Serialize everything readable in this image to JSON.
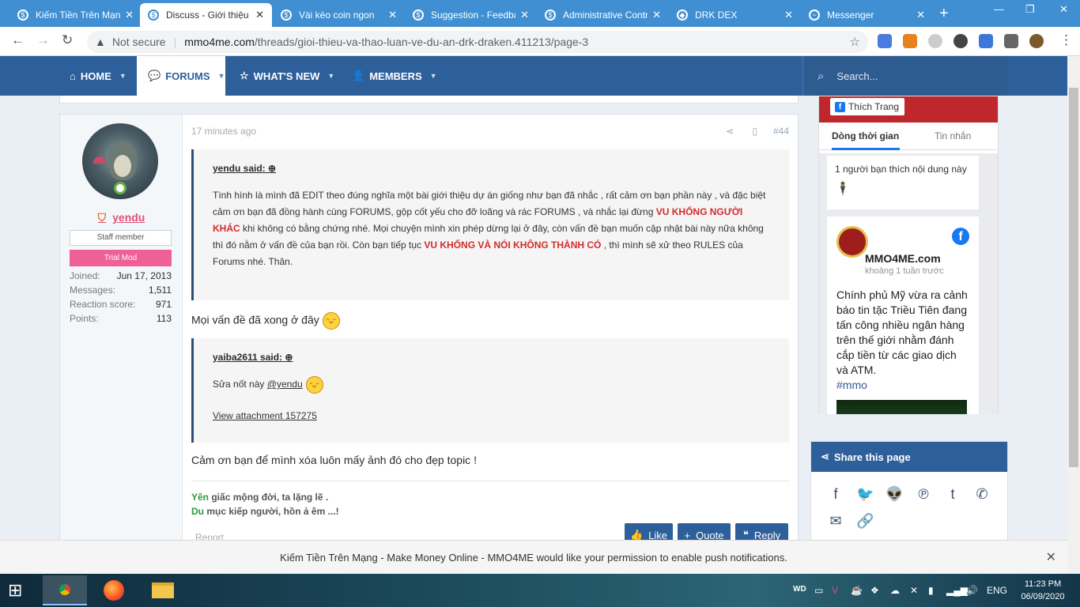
{
  "browser": {
    "tabs": [
      {
        "title": "Kiếm Tiền Trên Mạng",
        "icon": "mmo4me-favicon"
      },
      {
        "title": "Discuss - Giới thiệu",
        "icon": "mmo4me-favicon",
        "active": true
      },
      {
        "title": "Vài kèo coin ngon",
        "icon": "mmo4me-favicon"
      },
      {
        "title": "Suggestion - Feedback",
        "icon": "mmo4me-favicon"
      },
      {
        "title": "Administrative Control",
        "icon": "mmo4me-favicon"
      },
      {
        "title": "DRK DEX",
        "icon": "drk-favicon"
      },
      {
        "title": "Messenger",
        "icon": "messenger-favicon"
      }
    ],
    "security": "Not secure",
    "url_host": "mmo4me.com",
    "url_path": "/threads/gioi-thieu-va-thao-luan-ve-du-an-drk-draken.411213/page-3"
  },
  "site_nav": {
    "home": "HOME",
    "forums": "FORUMS",
    "whats_new": "WHAT'S NEW",
    "members": "MEMBERS",
    "search_placeholder": "Search..."
  },
  "post": {
    "time": "17 minutes ago",
    "number": "#44",
    "user": {
      "name": "yendu",
      "title": "Staff member",
      "banner": "Trial Mod",
      "stats": [
        {
          "label": "Joined:",
          "value": "Jun 17, 2013"
        },
        {
          "label": "Messages:",
          "value": "1,511"
        },
        {
          "label": "Reaction score:",
          "value": "971"
        },
        {
          "label": "Points:",
          "value": "113"
        }
      ]
    },
    "quote1": {
      "author": "yendu said:",
      "t1": "Tình hình là mình đã EDIT theo đúng nghĩa một bài giới thiệu dự án giống như bạn đã nhắc , rất cảm ơn bạn phần này , và đặc biệt cảm ơn bạn đã đồng hành cùng FORUMS, gộp cốt yếu cho đỡ loãng và rác FORUMS , và nhắc lại đừng ",
      "red1": "VU KHỐNG NGƯỜI KHÁC",
      "t2": " khi không có bằng chứng nhé. Mọi chuyện mình xin phép dừng lại ở đây, còn vấn đề bạn muốn cập nhật bài này nữa không thì đó nằm ở vấn đề của bạn rồi. Còn bạn tiếp tục ",
      "red2": "VU KHỐNG VÀ NÓI KHÔNG THÀNH CÓ",
      "t3": " , thì mình sẽ xử theo RULES của Forums nhé. Thân."
    },
    "line1": "Mọi vấn đề đã xong ở đây",
    "quote2": {
      "author": "yaiba2611 said:",
      "text": "Sửa nốt này",
      "mention": "@yendu",
      "attachment": "View attachment 157275"
    },
    "line2": "Cảm ơn bạn để mình xóa luôn mấy ảnh đó cho đẹp topic !",
    "signature": {
      "l1_green": "Yên",
      "l1_rest": " giấc mộng đời, ta lặng lẽ .",
      "l2_green": "Du",
      "l2_rest": " mục kiếp người, hồn ả êm ...!"
    },
    "report": "Report",
    "like": "Like",
    "quote_btn": "Quote",
    "reply": "Reply"
  },
  "facebook": {
    "like_label": "Thích Trang",
    "tab_timeline": "Dòng thời gian",
    "tab_messages": "Tin nhắn",
    "notice": "1 người bạn thích nội dung này",
    "page_name": "MMO4ME.com",
    "post_time": "khoảng 1 tuần trước",
    "post_text": "Chính phủ Mỹ vừa ra cảnh báo tin tặc Triều Tiên đang tấn công nhiều ngân hàng trên thế giới nhằm đánh cắp tiền từ các giao dịch và ATM.",
    "hashtag": "#mmo"
  },
  "share": {
    "title": "Share this page",
    "icons": [
      "facebook-icon",
      "twitter-icon",
      "reddit-icon",
      "pinterest-icon",
      "tumblr-icon",
      "whatsapp-icon",
      "email-icon",
      "link-icon"
    ]
  },
  "notification": {
    "site": "Kiếm Tiền Trên Mạng - Make Money Online - MMO4ME",
    "text": " would like your permission to ",
    "link": "enable push notifications."
  },
  "taskbar": {
    "lang": "ENG",
    "time": "11:23 PM",
    "date": "06/09/2020"
  },
  "colors": {
    "chrome_tabbar": "#3f8fd2",
    "site_nav": "#2d5f9a",
    "username": "#e0507a",
    "trial_mod": "#ef5f98",
    "warning_red": "#d62a2a"
  }
}
